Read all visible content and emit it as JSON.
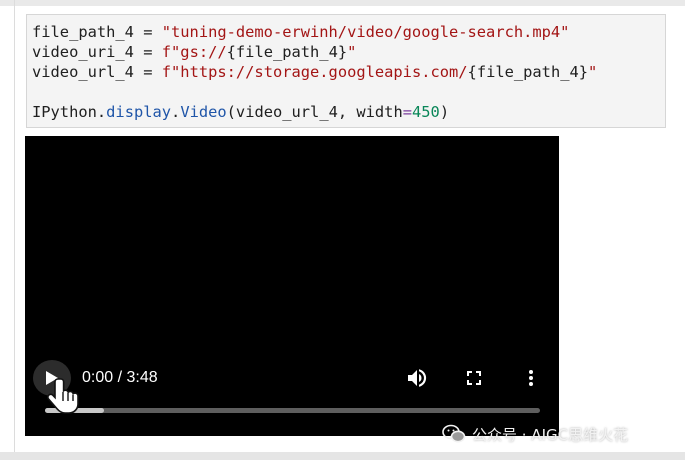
{
  "code_cell": {
    "lines": {
      "l1": {
        "var": "file_path_4",
        "op": " = ",
        "value": "\"tuning-demo-erwinh/video/google-search.mp4\""
      },
      "l2": {
        "var": "video_uri_4",
        "op": " = ",
        "prefix": "f",
        "str_open": "\"gs://",
        "expr": "{file_path_4}",
        "str_close": "\""
      },
      "l3": {
        "var": "video_url_4",
        "op": " = ",
        "prefix": "f",
        "str_open": "\"https://storage.googleapis.com/",
        "expr": "{file_path_4}",
        "str_close": "\""
      },
      "l5": {
        "module": "IPython",
        "dot1": ".",
        "func1": "display",
        "dot2": ".",
        "func2": "Video",
        "args_open": "(video_url_4, width",
        "eq": "=",
        "num": "450",
        "args_close": ")"
      }
    }
  },
  "video_player": {
    "time_display": "0:00 / 3:48",
    "progress": 0.12,
    "icons": {
      "play": "play-icon",
      "volume": "volume-icon",
      "fullscreen": "fullscreen-icon",
      "more": "more-vert-icon",
      "cursor": "hand-pointer-icon"
    }
  },
  "watermark": {
    "text": "公众号 · AIGC思维火花",
    "icon": "wechat-icon"
  },
  "colors": {
    "string": "#a31515",
    "keyword": "#7a3e9d",
    "number": "#098658",
    "video_bg": "#000000"
  }
}
